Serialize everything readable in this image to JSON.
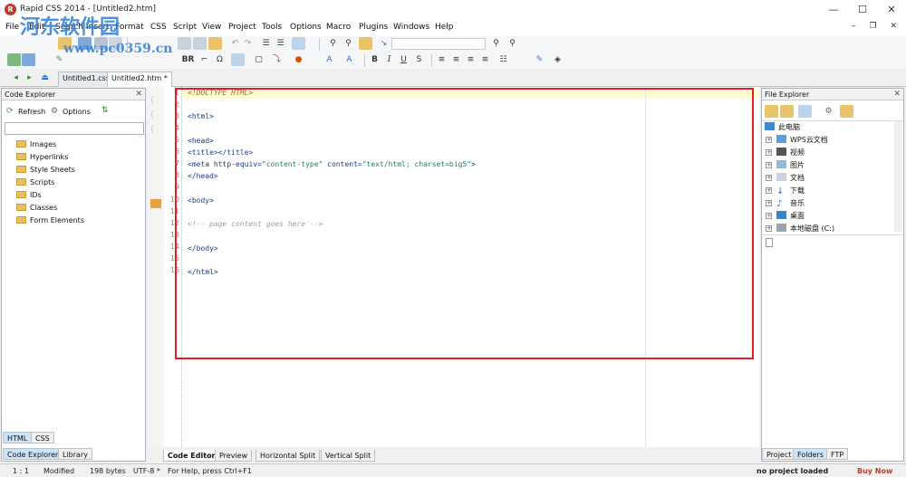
{
  "window": {
    "title": "Rapid CSS 2014 - [Untitled2.htm]",
    "controls": {
      "minimize": "—",
      "maximize": "☐",
      "close": "✕"
    }
  },
  "menu": [
    "File",
    "Edit",
    "Search",
    "Insert",
    "Format",
    "CSS",
    "Script",
    "View",
    "Project",
    "Tools",
    "Options",
    "Macro",
    "Plugins",
    "Windows",
    "Help"
  ],
  "watermark": {
    "line1": "河东软件园",
    "line2": "www.pc0359.cn"
  },
  "doc_tabs": [
    {
      "label": "Untitled1.css",
      "active": false
    },
    {
      "label": "Untitled2.htm *",
      "active": true
    }
  ],
  "code_explorer": {
    "title": "Code Explorer",
    "refresh_label": "Refresh",
    "options_label": "Options",
    "items": [
      "Images",
      "Hyperlinks",
      "Style Sheets",
      "Scripts",
      "IDs",
      "Classes",
      "Form Elements"
    ],
    "bottom_tabs_top": [
      "HTML",
      "CSS"
    ],
    "bottom_tabs": [
      "Code Explorer",
      "Library"
    ]
  },
  "editor": {
    "line_numbers": [
      "1",
      "2",
      "3",
      "4",
      "5",
      "6",
      "7",
      "8",
      "9",
      "10",
      "11",
      "12",
      "13",
      "14",
      "15",
      "16"
    ],
    "bottom_tabs": [
      "Code Editor",
      "Preview",
      "Horizontal Split",
      "Vertical Split"
    ]
  },
  "file_explorer": {
    "title": "File Explorer",
    "root": "此电脑",
    "items": [
      "WPS云文档",
      "视频",
      "图片",
      "文档",
      "下载",
      "音乐",
      "桌面",
      "本地磁盘 (C:)"
    ],
    "bottom_tabs": [
      "Project",
      "Folders",
      "FTP"
    ]
  },
  "status": {
    "position": "1 : 1",
    "state": "Modified",
    "size": "198 bytes",
    "encoding": "UTF-8 *",
    "help": "For Help, press Ctrl+F1",
    "project": "no project loaded",
    "buy": "Buy Now"
  },
  "colors": {
    "accent_red": "#e02020",
    "highlight_line": "#fffbd5",
    "active_tab": "#cde3f7",
    "buy_now": "#c0392b"
  }
}
